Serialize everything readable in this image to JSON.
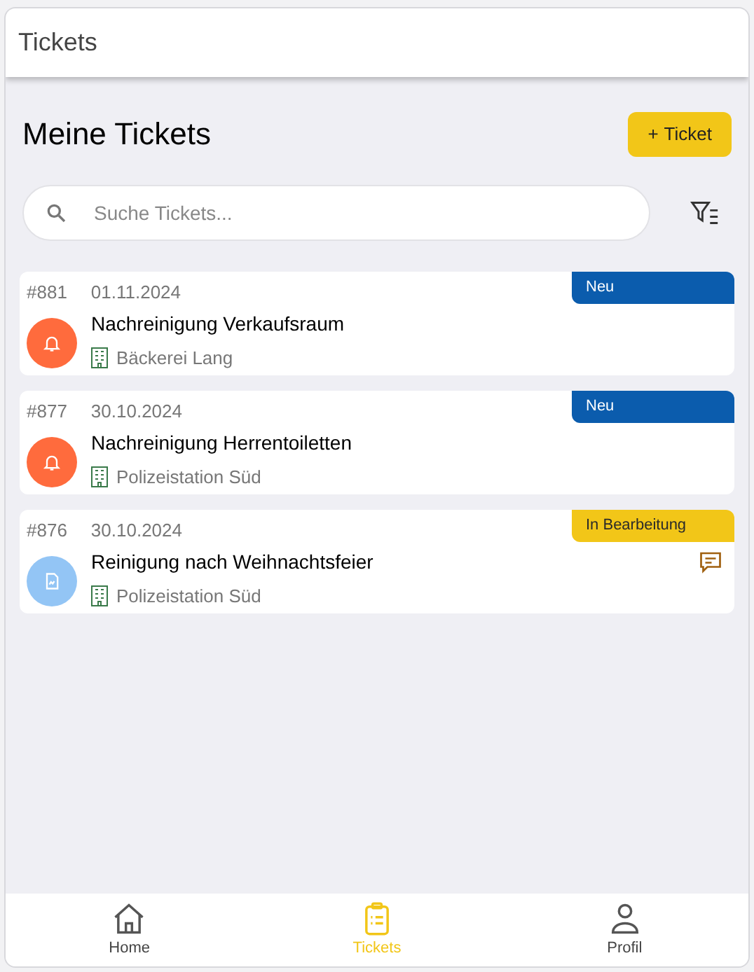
{
  "app_bar": {
    "title": "Tickets"
  },
  "heading": "Meine Tickets",
  "add_button": {
    "icon": "+",
    "label": "Ticket"
  },
  "search": {
    "placeholder": "Suche Tickets..."
  },
  "tickets": [
    {
      "number": "#881",
      "date": "01.11.2024",
      "title": "Nachreinigung Verkaufsraum",
      "location": "Bäckerei Lang",
      "status": {
        "kind": "new",
        "label": "Neu"
      },
      "kind": "bell",
      "has_comment": false
    },
    {
      "number": "#877",
      "date": "30.10.2024",
      "title": "Nachreinigung Herrentoiletten",
      "location": "Polizeistation Süd",
      "status": {
        "kind": "new",
        "label": "Neu"
      },
      "kind": "bell",
      "has_comment": false
    },
    {
      "number": "#876",
      "date": "30.10.2024",
      "title": "Reinigung nach Weihnachtsfeier",
      "location": "Polizeistation Süd",
      "status": {
        "kind": "in_progress",
        "label": "In Bearbeitung"
      },
      "kind": "document",
      "has_comment": true
    }
  ],
  "bottom_nav": [
    {
      "kind": "home",
      "label": "Home",
      "selected": false
    },
    {
      "kind": "tickets",
      "label": "Tickets",
      "selected": true
    },
    {
      "kind": "profile",
      "label": "Profil",
      "selected": false
    }
  ]
}
